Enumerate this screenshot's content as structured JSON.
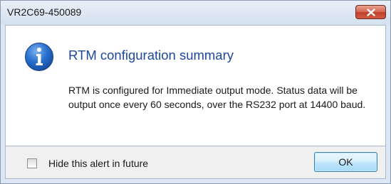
{
  "window": {
    "title": "VR2C69-450089",
    "close_icon": "close-icon"
  },
  "alert": {
    "icon": "info-icon",
    "heading": "RTM configuration summary",
    "message": "RTM is configured for Immediate output mode. Status data will be output once every 60 seconds, over the RS232 port at 14400 baud."
  },
  "footer": {
    "checkbox_label": "Hide this alert in future",
    "checkbox_checked": false,
    "ok_label": "OK"
  },
  "colors": {
    "heading": "#1f47a0",
    "close_button": "#c94f3a",
    "info_icon": "#1e5fbd"
  }
}
